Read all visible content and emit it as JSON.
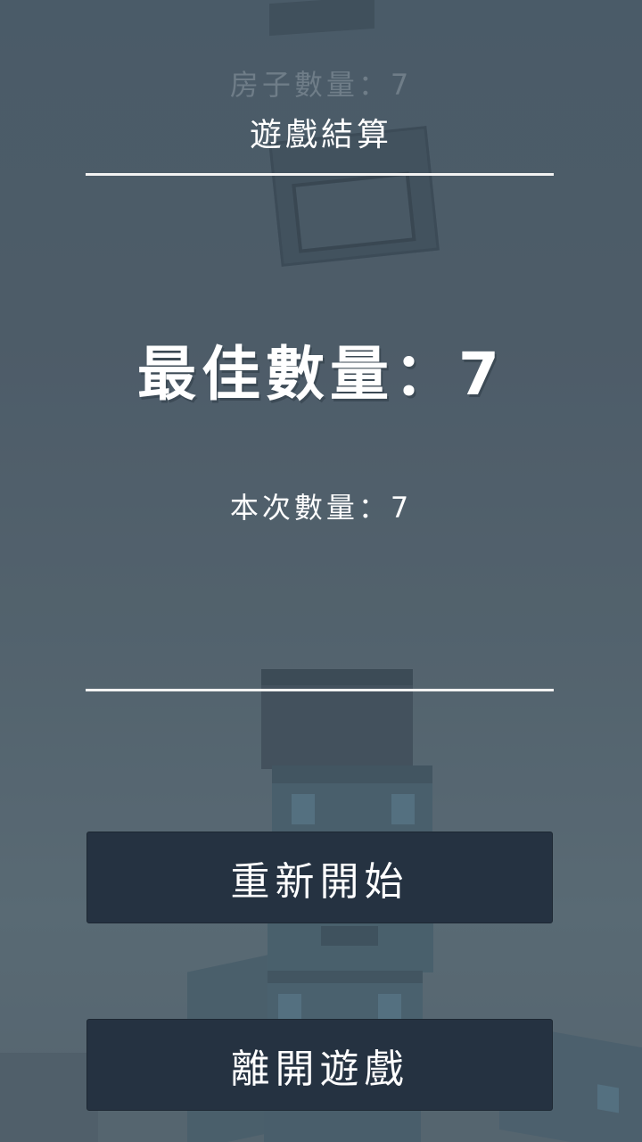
{
  "hud": {
    "house_count": "房子數量：7"
  },
  "result_panel": {
    "title": "遊戲結算",
    "best_count": "最佳數量：7",
    "current_count": "本次數量：7"
  },
  "buttons": {
    "restart": "重新開始",
    "quit": "離開遊戲"
  },
  "game_state": {
    "houses_stacked": 7,
    "best_houses": 7
  },
  "colors": {
    "button_bg": "#253241",
    "text": "#ffffff",
    "divider": "#f2f2f2"
  }
}
